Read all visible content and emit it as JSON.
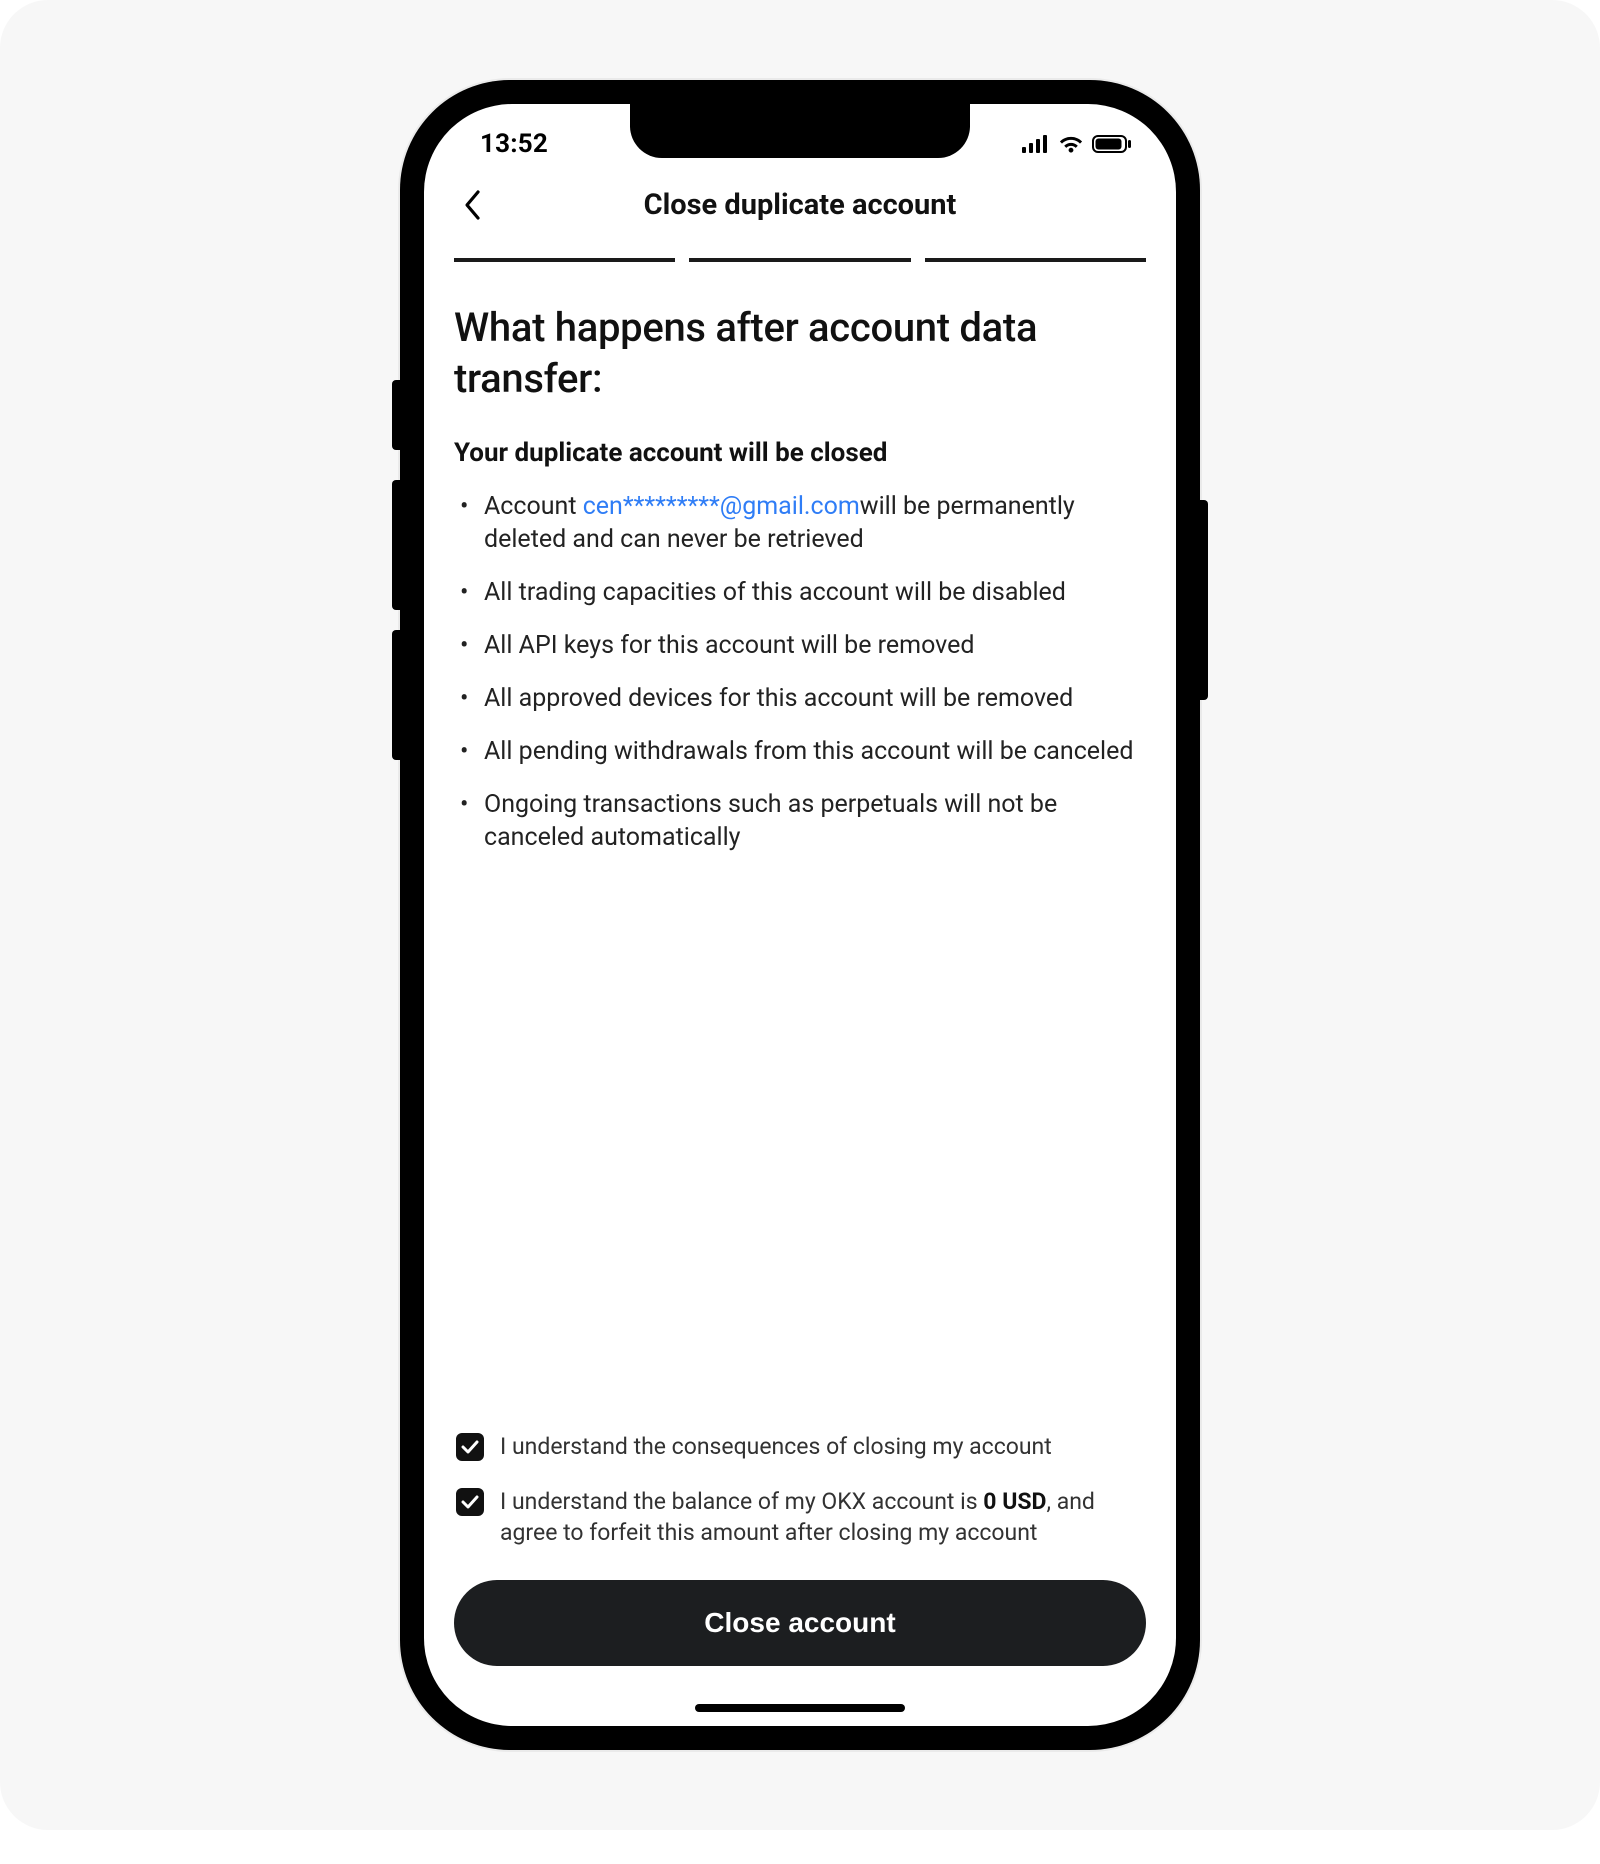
{
  "status": {
    "time": "13:52"
  },
  "nav": {
    "title": "Close duplicate account"
  },
  "page": {
    "heading": "What happens after account data transfer:",
    "subheading": "Your duplicate account will be closed",
    "bullet1_prefix": "Account ",
    "bullet1_email": "cen*********@gmail.com",
    "bullet1_suffix": "will be permanently deleted and can never be retrieved",
    "bullet2": "All trading capacities of this account will be disabled",
    "bullet3": "All API keys for this account will be removed",
    "bullet4": "All approved devices for this account will be removed",
    "bullet5": "All pending withdrawals from this account will be canceled",
    "bullet6": "Ongoing transactions such as perpetuals will not be canceled automatically"
  },
  "checks": {
    "c1": "I understand the consequences of closing my account",
    "c2_prefix": "I understand the balance of my OKX account is ",
    "c2_amount": "0 USD",
    "c2_suffix": ", and agree to forfeit this amount after closing my account"
  },
  "cta": {
    "label": "Close account"
  }
}
